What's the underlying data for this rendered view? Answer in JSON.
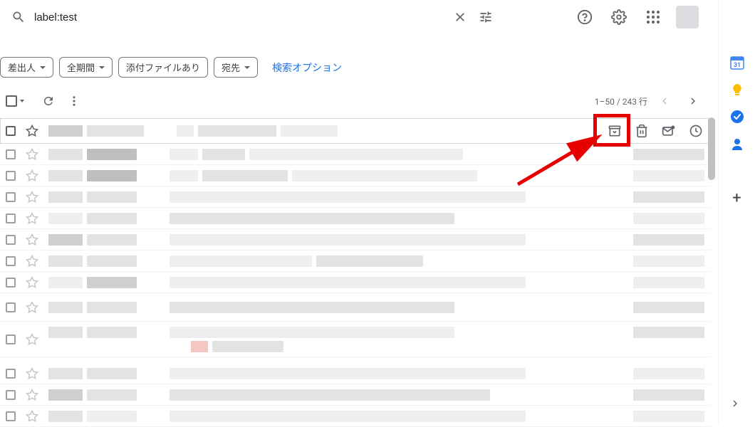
{
  "search": {
    "value": "label:test"
  },
  "filters": {
    "sender": "差出人",
    "period": "全期間",
    "attachment": "添付ファイルあり",
    "recipient": "宛先",
    "options": "検索オプション"
  },
  "pagination": {
    "range": "1–50 / 243 行"
  },
  "icons": {
    "calendar": "calendar",
    "keep": "keep",
    "tasks": "tasks",
    "contacts": "contacts"
  }
}
